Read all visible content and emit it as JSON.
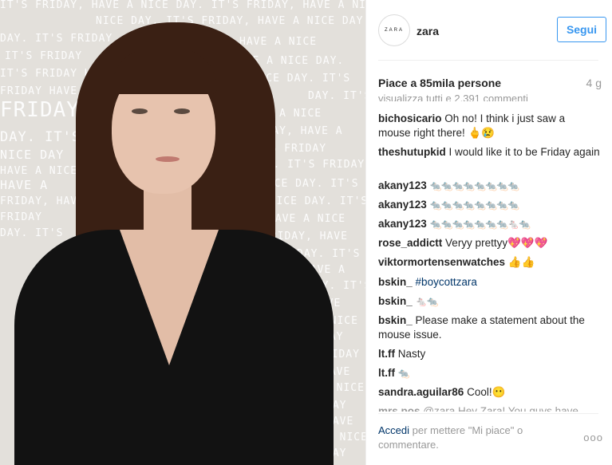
{
  "photo": {
    "wall_lines": [
      "IT'S FRIDAY, HAVE A NICE DAY. IT'S FRIDAY, HAVE A NICE",
      "NICE DAY. IT'S FRIDAY, HAVE A NICE DAY. IT'S FRIDAY, HAVE A NICE",
      "DAY. IT'S FRIDAY",
      "IT'S FRIDAY",
      "IT'S FRIDAY HAVE",
      "FRIDAY HAVE",
      "FRIDAY",
      "DAY. IT'S",
      "NICE DAY",
      "HAVE A NICE",
      "HAVE A",
      "FRIDAY, HAVE",
      "FRIDAY",
      "DAY. IT'S",
      "HAVE A NICE",
      "HAVE A NICE DAY.",
      "A NICE DAY. IT'S",
      "DAY. IT'S",
      "HAVE A NICE",
      "FRIDAY, HAVE A",
      "IT'S FRIDAY",
      "DAY. IT'S FRIDAY",
      "NICE DAY. IT'S",
      "A NICE DAY. IT'S",
      "HAVE A NICE",
      "FRIDAY, HAVE",
      "DAY. IT'S",
      "HAVE A",
      "DAY. IT'S",
      "HAVE",
      "A NICE",
      "DAY",
      "FRIDAY",
      "HAVE",
      "A NICE",
      "DAY",
      "HAVE",
      "A NICE",
      "DAY"
    ]
  },
  "header": {
    "avatar_text": "ZARA",
    "username": "zara",
    "follow_label": "Segui"
  },
  "stats": {
    "likes": "Piace a 85mila persone",
    "age": "4 g"
  },
  "comments": {
    "clipped_top": "visualizza tutti e 2.391 commenti",
    "items": [
      {
        "user": "bichosicario",
        "text": "Oh no! I think i just saw a mouse right there! 🖕😢"
      },
      {
        "user": "theshutupkid",
        "text": "I would like it to be Friday again"
      },
      {
        "user": "akany123",
        "text": "🐀🐀🐀🐀🐀🐀🐀🐀"
      },
      {
        "user": "akany123",
        "text": "🐀🐀🐀🐀🐀🐀🐀🐀"
      },
      {
        "user": "akany123",
        "text": "🐀🐀🐀🐀🐀🐀🐀🐁🐀"
      },
      {
        "user": "rose_addictt",
        "text": "Veryy prettyy💖💖💖"
      },
      {
        "user": "viktormortensenwatches",
        "text": "👍👍"
      },
      {
        "user": "bskin_",
        "text": "#boycottzara"
      },
      {
        "user": "bskin_",
        "text": "🐁🐀"
      },
      {
        "user": "bskin_",
        "text": "Please make a statement about the mouse issue."
      },
      {
        "user": "lt.ff",
        "text": "Nasty"
      },
      {
        "user": "lt.ff",
        "text": "🐀"
      },
      {
        "user": "sandra.aguilar86",
        "text": "Cool!😶"
      },
      {
        "user": "mrs.pos",
        "text": "@zara Hey Zara! You guys have"
      }
    ]
  },
  "footer": {
    "login_link": "Accedi",
    "login_rest": " per mettere \"Mi piace\" o commentare.",
    "more": "ooo"
  },
  "colors": {
    "link_blue": "#3897f0",
    "hashtag": "#003569",
    "wall": "#e3e0db"
  }
}
